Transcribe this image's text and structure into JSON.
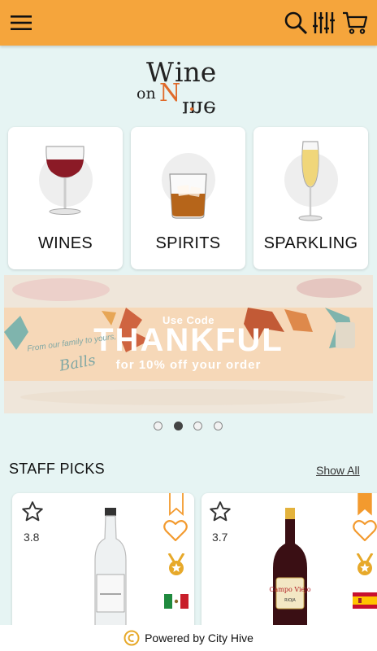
{
  "header": {
    "menu_icon": "hamburger-menu-icon",
    "search_icon": "search-icon",
    "filter_icon": "filter-sliders-icon",
    "cart_icon": "shopping-cart-icon",
    "color": "#f5a53c"
  },
  "brand": {
    "logo_line1": "Wine",
    "logo_line2": "on"
  },
  "categories": [
    {
      "label": "WINES",
      "icon": "red-wine-glass-icon"
    },
    {
      "label": "SPIRITS",
      "icon": "whiskey-glass-icon"
    },
    {
      "label": "SPARKLING",
      "icon": "champagne-flute-icon"
    }
  ],
  "banner": {
    "code_prefix": "Use Code",
    "code": "THANKFUL",
    "offer": "for 10% off your order",
    "tagline": "From our family to yours,",
    "brand": "Balls",
    "slide_count": 4,
    "active_slide": 2
  },
  "staff_picks": {
    "title": "STAFF PICKS",
    "show_all": "Show All",
    "products": [
      {
        "rating": "3.8",
        "bookmarked": false,
        "country": "Mexico",
        "bottle": "tequila-bottle"
      },
      {
        "rating": "3.7",
        "bookmarked": true,
        "country": "Spain",
        "bottle": "red-wine-bottle"
      }
    ]
  },
  "footer": {
    "text": "Powered by City Hive"
  },
  "colors": {
    "accent": "#f5a53c",
    "background": "#e6f4f3",
    "heart": "#f39a2e",
    "medal": "#e7a92a"
  }
}
